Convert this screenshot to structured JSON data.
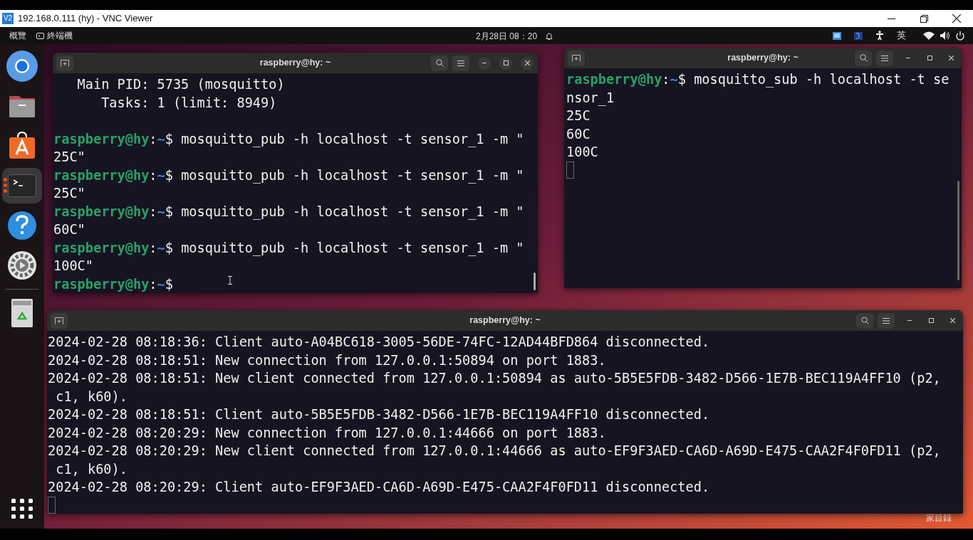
{
  "vnc_window": {
    "logo": "V2",
    "title": "192.168.0.111 (hy) - VNC Viewer"
  },
  "top_bar": {
    "activities": "概覽",
    "app_menu": "終端機",
    "clock": "2月28日 08：20",
    "input_method": "英"
  },
  "dock": {
    "items": [
      {
        "kind": "browser",
        "selected": false,
        "running": false
      },
      {
        "kind": "files",
        "selected": false,
        "running": false
      },
      {
        "kind": "store",
        "selected": false,
        "running": false
      },
      {
        "kind": "terminal",
        "selected": true,
        "running": true
      },
      {
        "kind": "help",
        "selected": false,
        "running": false
      },
      {
        "kind": "settings",
        "selected": false,
        "running": false
      },
      {
        "kind": "trash",
        "selected": false,
        "running": false
      }
    ]
  },
  "terminals": [
    {
      "title": "raspberry@hy: ~",
      "lines": [
        {
          "kind": "output",
          "text": "   Main PID: 5735 (mosquitto)"
        },
        {
          "kind": "output",
          "text": "      Tasks: 1 (limit: 8949)"
        },
        {
          "kind": "blank"
        },
        {
          "kind": "prompt",
          "user": "raspberry@hy",
          "sep": ":",
          "path": "~",
          "sign": "$",
          "command": "mosquitto_pub -h localhost -t sensor_1 -m \""
        },
        {
          "kind": "output",
          "text": "25C\""
        },
        {
          "kind": "prompt",
          "user": "raspberry@hy",
          "sep": ":",
          "path": "~",
          "sign": "$",
          "command": "mosquitto_pub -h localhost -t sensor_1 -m \""
        },
        {
          "kind": "output",
          "text": "25C\""
        },
        {
          "kind": "prompt",
          "user": "raspberry@hy",
          "sep": ":",
          "path": "~",
          "sign": "$",
          "command": "mosquitto_pub -h localhost -t sensor_1 -m \""
        },
        {
          "kind": "output",
          "text": "60C\""
        },
        {
          "kind": "prompt",
          "user": "raspberry@hy",
          "sep": ":",
          "path": "~",
          "sign": "$",
          "command": "mosquitto_pub -h localhost -t sensor_1 -m \""
        },
        {
          "kind": "output",
          "text": "100C\""
        },
        {
          "kind": "prompt",
          "user": "raspberry@hy",
          "sep": ":",
          "path": "~",
          "sign": "$"
        }
      ]
    },
    {
      "title": "raspberry@hy: ~",
      "lines": [
        {
          "kind": "prompt",
          "user": "raspberry@hy",
          "sep": ":",
          "path": "~",
          "sign": "$",
          "command": "mosquitto_sub -h localhost -t se"
        },
        {
          "kind": "output",
          "text": "nsor_1"
        },
        {
          "kind": "output",
          "text": "25C"
        },
        {
          "kind": "output",
          "text": "60C"
        },
        {
          "kind": "output",
          "text": "100C"
        },
        {
          "kind": "cursor"
        }
      ]
    },
    {
      "title": "raspberry@hy: ~",
      "lines": [
        {
          "kind": "output",
          "text": "2024-02-28 08:18:36: Client auto-A04BC618-3005-56DE-74FC-12AD44BFD864 disconnected."
        },
        {
          "kind": "output",
          "text": "2024-02-28 08:18:51: New connection from 127.0.0.1:50894 on port 1883."
        },
        {
          "kind": "output",
          "text": "2024-02-28 08:18:51: New client connected from 127.0.0.1:50894 as auto-5B5E5FDB-3482-D566-1E7B-BEC119A4FF10 (p2,"
        },
        {
          "kind": "output",
          "text": " c1, k60)."
        },
        {
          "kind": "output",
          "text": "2024-02-28 08:18:51: Client auto-5B5E5FDB-3482-D566-1E7B-BEC119A4FF10 disconnected."
        },
        {
          "kind": "output",
          "text": "2024-02-28 08:20:29: New connection from 127.0.0.1:44666 on port 1883."
        },
        {
          "kind": "output",
          "text": "2024-02-28 08:20:29: New client connected from 127.0.0.1:44666 as auto-EF9F3AED-CA6D-A69D-E475-CAA2F4F0FD11 (p2,"
        },
        {
          "kind": "output",
          "text": " c1, k60)."
        },
        {
          "kind": "output",
          "text": "2024-02-28 08:20:29: Client auto-EF9F3AED-CA6D-A69D-E475-CAA2F4F0FD11 disconnected."
        },
        {
          "kind": "cursor"
        }
      ]
    }
  ],
  "desktop": {
    "home_label": "家目録"
  }
}
